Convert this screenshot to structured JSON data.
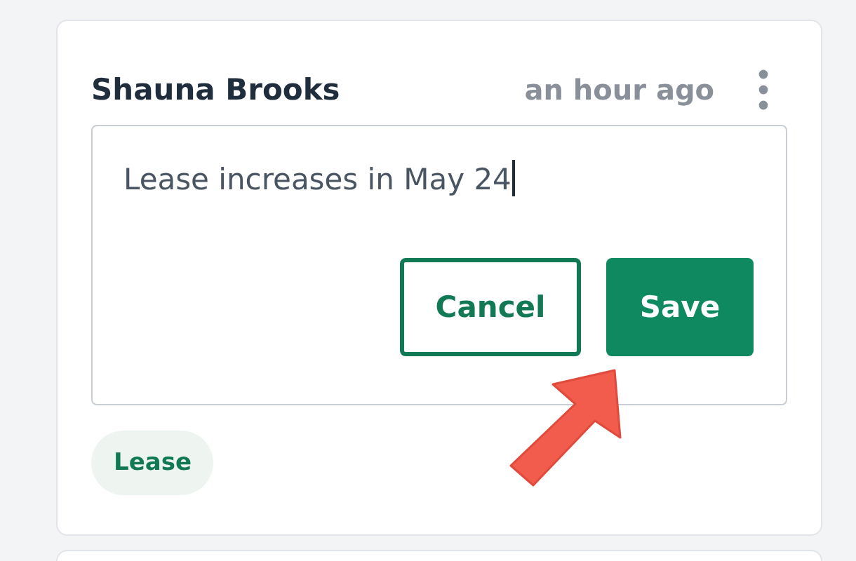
{
  "comment": {
    "author": "Shauna Brooks",
    "time": "an hour ago",
    "text": "Lease increases in May 24",
    "editing": true,
    "buttons": [
      {
        "label": "Cancel",
        "kind": "secondary"
      },
      {
        "label": "Save",
        "kind": "primary"
      }
    ],
    "tags": [
      {
        "label": "Lease"
      }
    ]
  }
}
